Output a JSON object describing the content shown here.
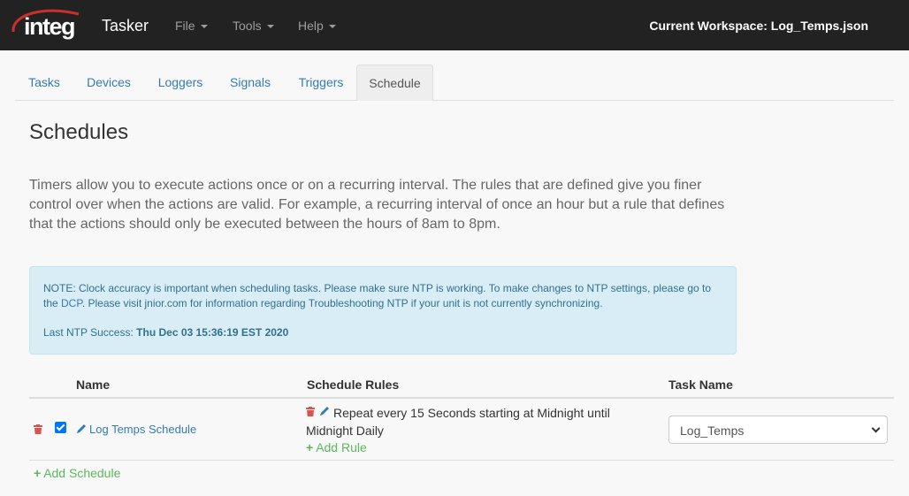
{
  "navbar": {
    "logo_text": "integ",
    "brand": "Tasker",
    "menus": [
      {
        "label": "File"
      },
      {
        "label": "Tools"
      },
      {
        "label": "Help"
      }
    ],
    "workspace": "Current Workspace: Log_Temps.json"
  },
  "tabs": [
    {
      "label": "Tasks"
    },
    {
      "label": "Devices"
    },
    {
      "label": "Loggers"
    },
    {
      "label": "Signals"
    },
    {
      "label": "Triggers"
    },
    {
      "label": "Schedule",
      "active": true
    }
  ],
  "page": {
    "title": "Schedules",
    "description": "Timers allow you to execute actions once or on a recurring interval. The rules that are defined give you finer control over when the actions are valid. For example, a recurring interval of once an hour but a rule that defines that the actions should only be executed between the hours of 8am to 8pm."
  },
  "alert": {
    "note_before_link": "NOTE: Clock accuracy is important when scheduling tasks. Please make sure NTP is working. To make changes to NTP settings, please go to the ",
    "link": "DCP",
    "note_after_link": ". Please visit jnior.com for information regarding Troubleshooting NTP if your unit is not currently synchronizing.",
    "ntp_label": "Last NTP Success:",
    "ntp_value": "Thu Dec 03 15:36:19 EST 2020"
  },
  "table": {
    "headers": {
      "name": "Name",
      "rules": "Schedule Rules",
      "task": "Task Name"
    },
    "rows": [
      {
        "checked": true,
        "name": "Log Temps Schedule",
        "rule": "Repeat every 15 Seconds starting at Midnight until Midnight Daily",
        "add_rule": "Add Rule",
        "task": "Log_Temps"
      }
    ],
    "add_schedule": "Add Schedule"
  },
  "colors": {
    "navbar": "#222222",
    "link": "#337ab7",
    "success": "#5cb85c",
    "danger": "#d9534f",
    "alert_bg": "#d9edf7"
  }
}
